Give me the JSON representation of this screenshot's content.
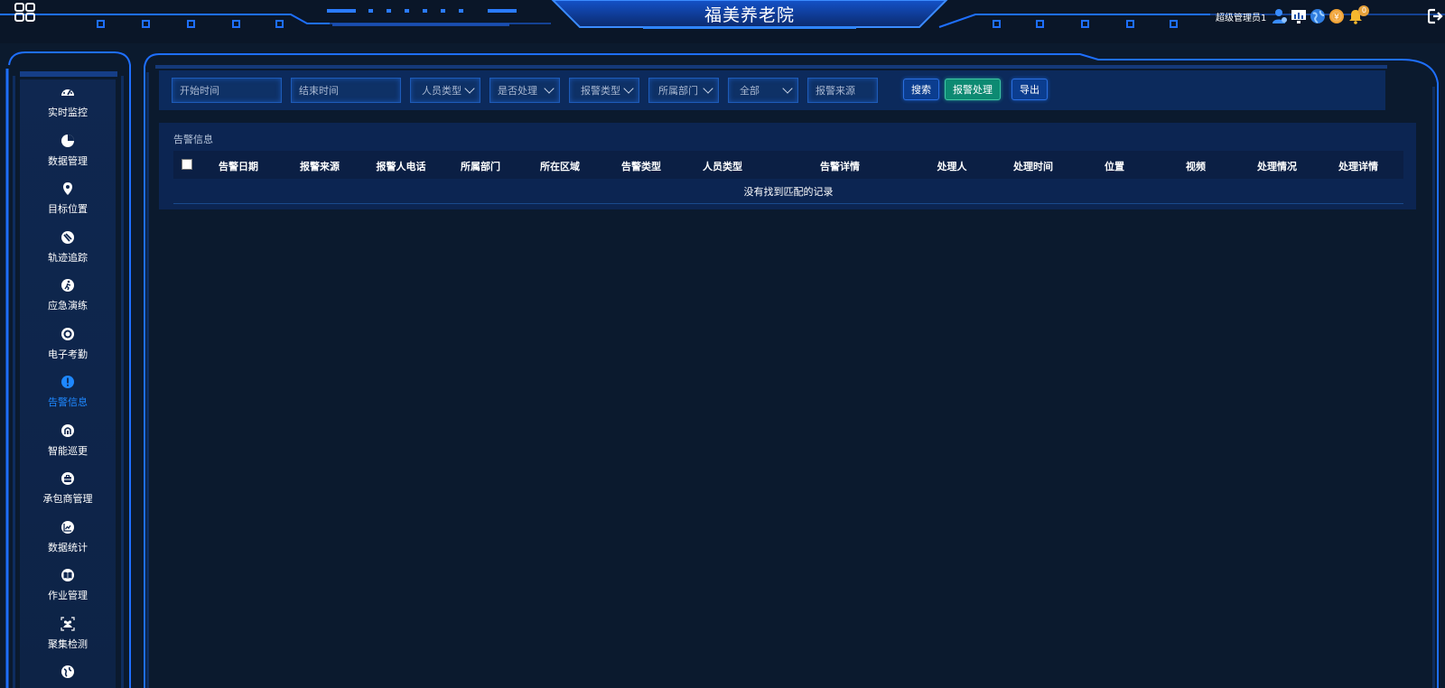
{
  "app": {
    "title": "福美养老院"
  },
  "user": {
    "name": "超级管理员1",
    "notification_count": "0"
  },
  "colors": {
    "accent": "#1e88ff",
    "panel": "#0c2552",
    "green": "#0d8a72",
    "bg": "#0b1a2e"
  },
  "sidebar": {
    "items": [
      {
        "label": "实时监控",
        "icon": "dashboard-icon"
      },
      {
        "label": "数据管理",
        "icon": "pie-chart-icon"
      },
      {
        "label": "目标位置",
        "icon": "location-pin-icon"
      },
      {
        "label": "轨迹追踪",
        "icon": "track-icon"
      },
      {
        "label": "应急演练",
        "icon": "running-person-icon"
      },
      {
        "label": "电子考勤",
        "icon": "target-icon"
      },
      {
        "label": "告警信息",
        "icon": "alert-icon",
        "active": true
      },
      {
        "label": "智能巡更",
        "icon": "patrol-icon"
      },
      {
        "label": "承包商管理",
        "icon": "briefcase-icon"
      },
      {
        "label": "数据统计",
        "icon": "bar-chart-icon"
      },
      {
        "label": "作业管理",
        "icon": "book-icon"
      },
      {
        "label": "聚集检测",
        "icon": "crowd-icon"
      },
      {
        "label": "",
        "icon": "globe-icon"
      }
    ]
  },
  "filters": {
    "start_time": "开始时间",
    "end_time": "结束时间",
    "person_type": "人员类型",
    "handled": "是否处理",
    "alarm_type": "报警类型",
    "department": "所属部门",
    "all": "全部",
    "alarm_source": "报警来源",
    "search": "搜索",
    "handle_alarm": "报警处理",
    "export": "导出"
  },
  "panel": {
    "title": "告警信息",
    "columns": [
      "告警日期",
      "报警来源",
      "报警人电话",
      "所属部门",
      "所在区域",
      "告警类型",
      "人员类型",
      "告警详情",
      "处理人",
      "处理时间",
      "位置",
      "视频",
      "处理情况",
      "处理详情"
    ],
    "empty": "没有找到匹配的记录"
  }
}
